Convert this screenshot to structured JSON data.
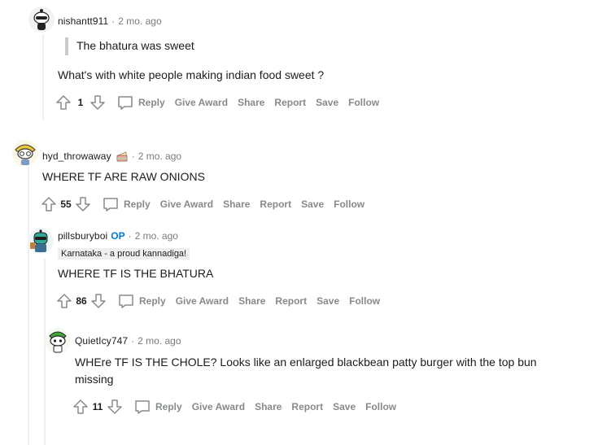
{
  "comments": [
    {
      "username": "nishantt911",
      "op": "",
      "time": "2 mo. ago",
      "quote": "The bhatura was sweet",
      "text": "What's with white people making indian food sweet ?",
      "votes": "1",
      "actions": {
        "reply": "Reply",
        "award": "Give Award",
        "share": "Share",
        "report": "Report",
        "save": "Save",
        "follow": "Follow"
      }
    },
    {
      "username": "hyd_throwaway",
      "op": "",
      "time": "2 mo. ago",
      "text": "WHERE TF ARE RAW ONIONS",
      "votes": "55",
      "actions": {
        "reply": "Reply",
        "award": "Give Award",
        "share": "Share",
        "report": "Report",
        "save": "Save",
        "follow": "Follow"
      }
    },
    {
      "username": "pillsburyboi",
      "op": "OP",
      "time": "2 mo. ago",
      "flair": "Karnataka - a proud kannadiga!",
      "text": "WHERE TF IS THE BHATURA",
      "votes": "86",
      "actions": {
        "reply": "Reply",
        "award": "Give Award",
        "share": "Share",
        "report": "Report",
        "save": "Save",
        "follow": "Follow"
      }
    },
    {
      "username": "QuietIcy747",
      "op": "",
      "time": "2 mo. ago",
      "text_line1": "WHEre TF IS THE CHOLE? Looks like an enlarged blackbean patty burger with the top bun",
      "text_line2": "missing",
      "votes": "11",
      "actions": {
        "reply": "Reply",
        "award": "Give Award",
        "share": "Share",
        "report": "Report",
        "save": "Save",
        "follow": "Follow"
      }
    }
  ],
  "separator": "·",
  "icons": {
    "upvote": "upvote-arrow-icon",
    "downvote": "downvote-arrow-icon",
    "reply": "speech-bubble-icon",
    "avatar": "snoo-avatar-icon",
    "badge": "cake-icon"
  },
  "colors": {
    "meta_gray": "#787c7e",
    "action_gray": "#878a8c",
    "op_blue": "#0079d3",
    "thread_line": "#edeff1"
  }
}
